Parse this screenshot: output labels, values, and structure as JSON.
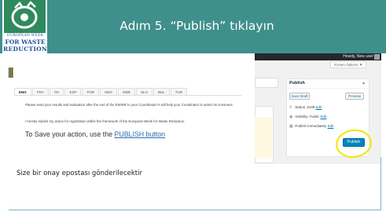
{
  "slide": {
    "title": "Adım 5. “Publish” tıklayın",
    "confirmation": "Size bir onay epostası gönderilecektir"
  },
  "logo": {
    "line1": "EUROPEAN WEEK",
    "line2": "FOR WASTE",
    "line3": "REDUCTION"
  },
  "wp": {
    "howdy": "Howdy, New user",
    "screen_options": "Screen Options ▼"
  },
  "content": {
    "tabs": [
      "ENG",
      "FRA",
      "ITA",
      "ESP",
      "POR",
      "NED",
      "SWE",
      "SLO",
      "BUL",
      "TUR"
    ],
    "paragraph1": "Please send your results and evaluation after the end of the EWWR to your Coordinator! It will help your Coordinator to select its nominees.",
    "paragraph2": "I hereby submit my action for registration within the framework of the European Week for Waste Reduction.",
    "save_prefix": "To Save your action, use the",
    "save_link": "PUBLISH button"
  },
  "publish_panel": {
    "title": "Publish",
    "save_draft": "Save Draft",
    "preview": "Preview",
    "status": "Status: Draft",
    "visibility": "Visibility: Public",
    "schedule": "Publish immediately",
    "edit": "Edit",
    "publish_button": "Publish"
  },
  "colors": {
    "header": "#3f8f8c",
    "publish_button": "#0085ba",
    "highlight": "#f2e600"
  }
}
